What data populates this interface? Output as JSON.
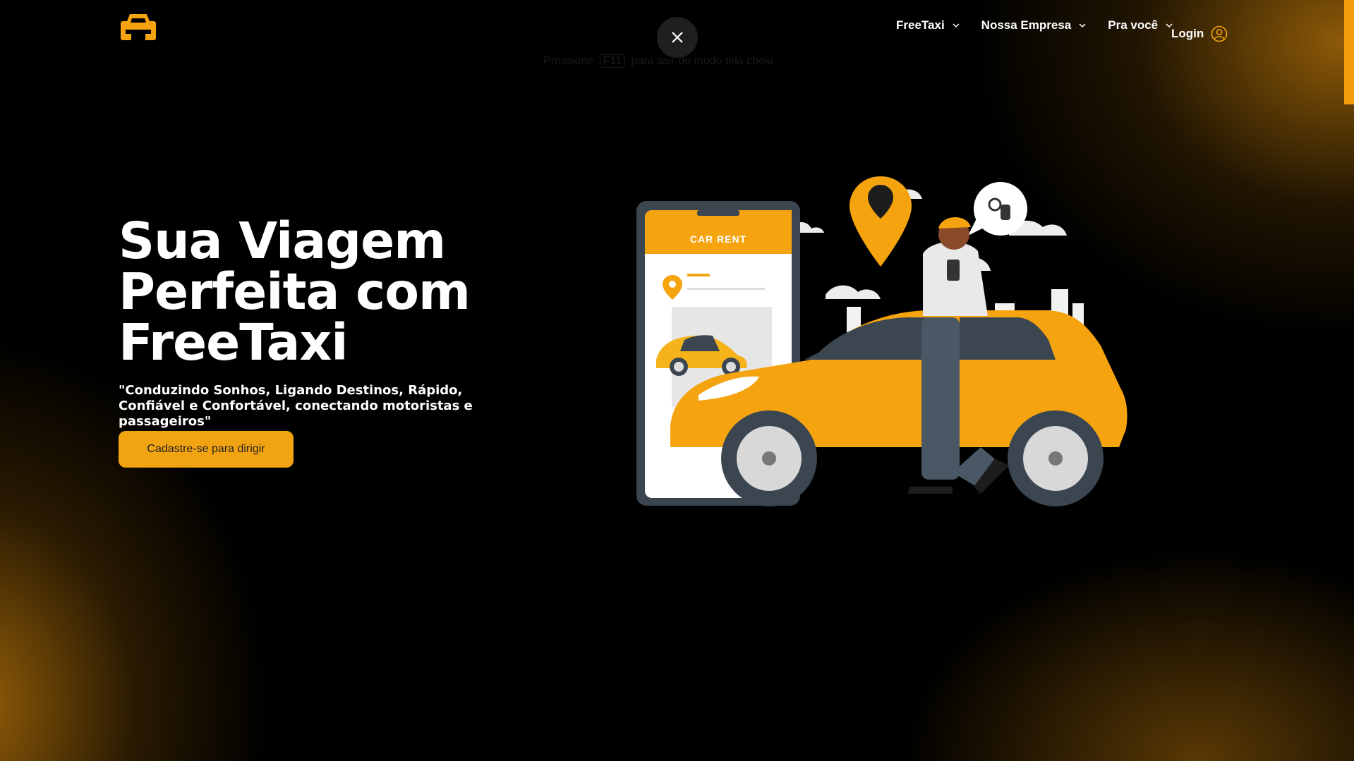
{
  "header": {
    "logo_icon": "taxi-logo-icon",
    "nav": [
      {
        "label": "FreeTaxi",
        "icon": "chevron-down-icon"
      },
      {
        "label": "Nossa Empresa",
        "icon": "chevron-down-icon"
      },
      {
        "label": "Pra você",
        "icon": "chevron-down-icon"
      }
    ],
    "login_label": "Login",
    "login_icon": "user-circle-icon"
  },
  "fullscreen": {
    "close_icon": "close-icon",
    "hint_prefix": "Pressione",
    "hint_key": "F11",
    "hint_suffix": "para sair do modo tela cheia"
  },
  "hero": {
    "title_line1": "Sua Viagem",
    "title_line2": "Perfeita com",
    "title_line3": "FreeTaxi",
    "subtitle": "\"Conduzindo Sonhos, Ligando Destinos, Rápido, Confiável e Confortável, conectando motoristas e passageiros\"",
    "cta_label": "Cadastre-se para dirigir"
  },
  "illustration": {
    "phone_header": "CAR RENT"
  },
  "colors": {
    "accent": "#f59e0b",
    "button": "#f2a312",
    "background": "#000000"
  }
}
